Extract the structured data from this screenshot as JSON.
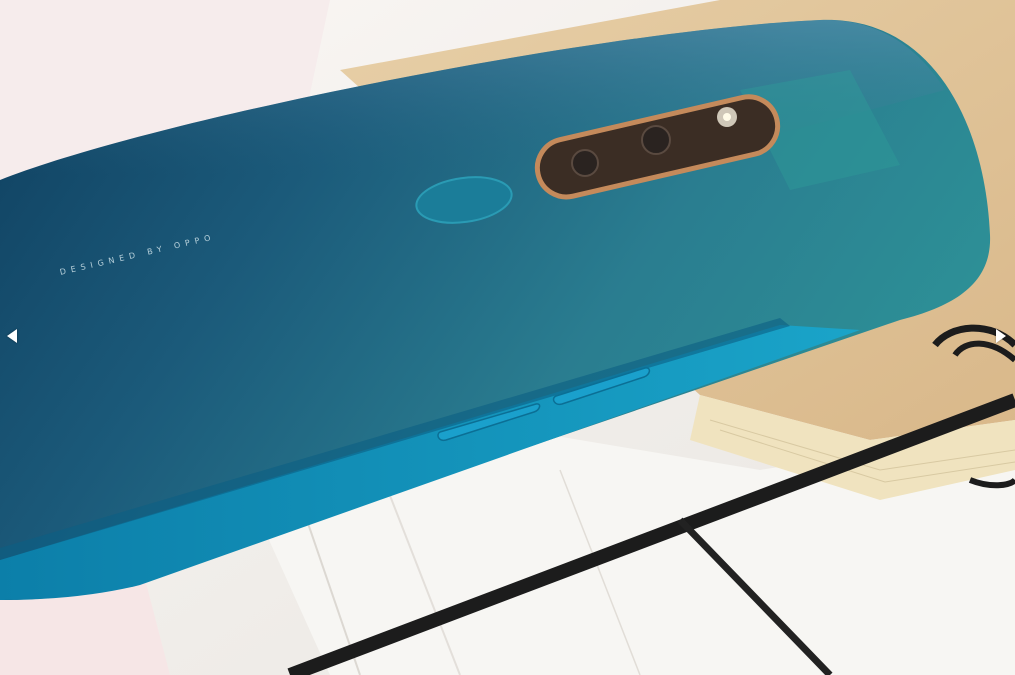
{
  "gallery": {
    "image_alt": "",
    "prev_label": "",
    "next_label": "",
    "phone": {
      "engraving": "DESIGNED BY OPPO",
      "body_color": "#1f6a86",
      "accent_color": "#1c9fc3",
      "camera_ring_color": "#c48a5b"
    }
  }
}
